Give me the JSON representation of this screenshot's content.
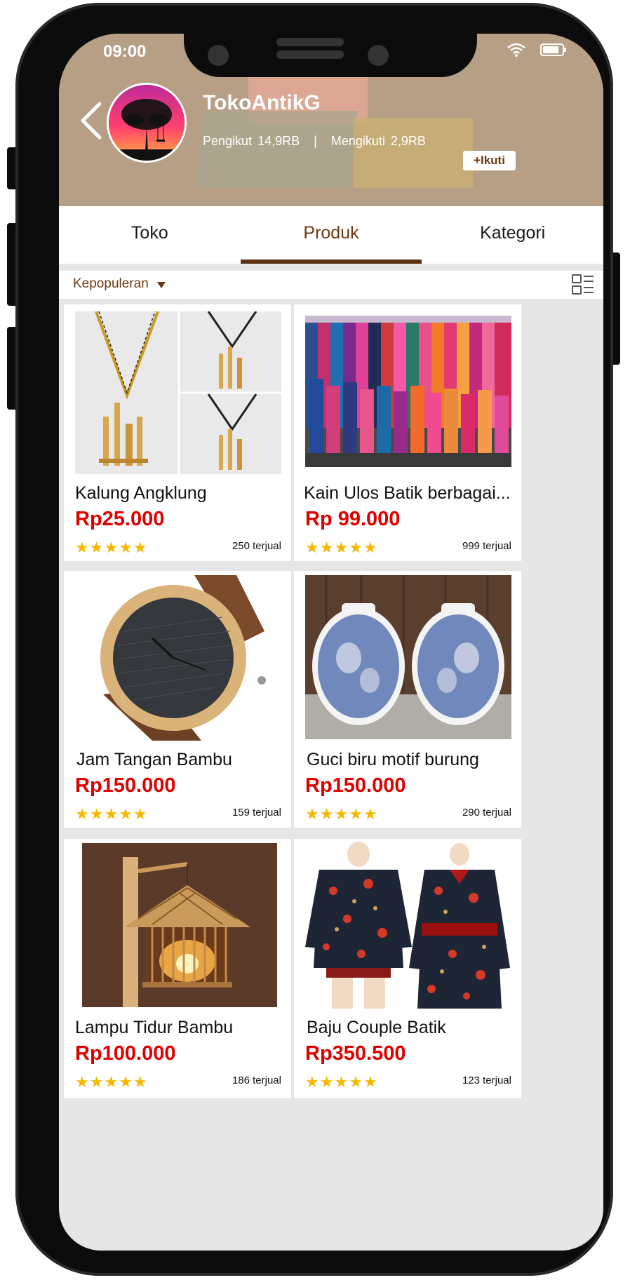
{
  "status_bar": {
    "time": "09:00"
  },
  "shop": {
    "name": "TokoAntikG",
    "followers_label": "Pengikut",
    "followers_value": "14,9RB",
    "separator": "|",
    "following_label": "Mengikuti",
    "following_value": "2,9RB",
    "follow_button": "+Ikuti"
  },
  "tabs": [
    {
      "label": "Toko",
      "active": false
    },
    {
      "label": "Produk",
      "active": true
    },
    {
      "label": "Kategori",
      "active": false
    }
  ],
  "sort": {
    "selected": "Kepopuleran"
  },
  "products": [
    {
      "name": "Kalung Angklung",
      "price": "Rp25.000",
      "rating_stars": 5,
      "sold": "250 terjual"
    },
    {
      "name": "Kain Ulos Batik berbagai...",
      "price": "Rp 99.000",
      "rating_stars": 5,
      "sold": "999 terjual"
    },
    {
      "name": "Jam Tangan Bambu",
      "price": "Rp150.000",
      "rating_stars": 5,
      "sold": "159 terjual"
    },
    {
      "name": "Guci biru motif burung",
      "price": "Rp150.000",
      "rating_stars": 5,
      "sold": "290 terjual"
    },
    {
      "name": "Lampu Tidur Bambu",
      "price": "Rp100.000",
      "rating_stars": 5,
      "sold": "186 terjual"
    },
    {
      "name": "Baju Couple Batik",
      "price": "Rp350.500",
      "rating_stars": 5,
      "sold": "123 terjual"
    }
  ],
  "colors": {
    "accent_brown": "#6b3a0f",
    "price_red": "#e00000",
    "star_yellow": "#f5b800",
    "header_bg": "#b79f86"
  },
  "icons": [
    "back-chevron-icon",
    "wifi-icon",
    "battery-icon",
    "list-view-icon",
    "caret-down-icon",
    "star-icon"
  ]
}
